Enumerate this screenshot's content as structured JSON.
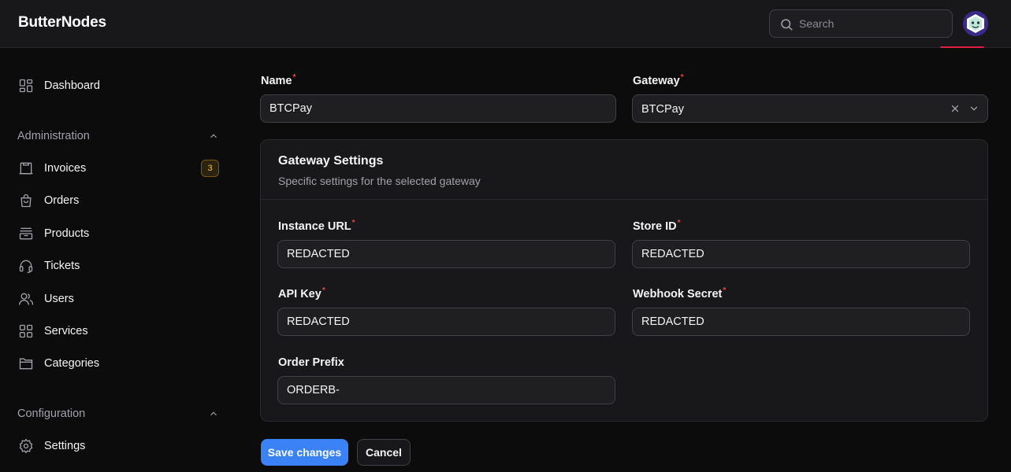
{
  "app": {
    "brand": "ButterNodes"
  },
  "search": {
    "placeholder": "Search",
    "value": ""
  },
  "sidebar": {
    "dashboard": {
      "label": "Dashboard",
      "icon": "dashboard-icon"
    },
    "groups": [
      {
        "title": "Administration",
        "items": [
          {
            "label": "Invoices",
            "icon": "invoice-icon",
            "badge": "3"
          },
          {
            "label": "Orders",
            "icon": "shopping-bag-icon"
          },
          {
            "label": "Products",
            "icon": "archive-box-icon"
          },
          {
            "label": "Tickets",
            "icon": "headset-icon"
          },
          {
            "label": "Users",
            "icon": "users-icon"
          },
          {
            "label": "Services",
            "icon": "grid-icon"
          },
          {
            "label": "Categories",
            "icon": "folder-icon"
          }
        ]
      },
      {
        "title": "Configuration",
        "items": [
          {
            "label": "Settings",
            "icon": "gear-icon"
          }
        ]
      }
    ]
  },
  "form": {
    "name": {
      "label": "Name",
      "value": "BTCPay"
    },
    "gateway": {
      "label": "Gateway",
      "value": "BTCPay"
    },
    "settings_card": {
      "title": "Gateway Settings",
      "subtitle": "Specific settings for the selected gateway",
      "instance_url": {
        "label": "Instance URL",
        "value": "REDACTED"
      },
      "store_id": {
        "label": "Store ID",
        "value": "REDACTED"
      },
      "api_key": {
        "label": "API Key",
        "value": "REDACTED"
      },
      "webhook_secret": {
        "label": "Webhook Secret",
        "value": "REDACTED"
      },
      "order_prefix": {
        "label": "Order Prefix",
        "value": "ORDERB-"
      }
    },
    "save_label": "Save changes",
    "cancel_label": "Cancel"
  },
  "colors": {
    "accent": "#3b82f6",
    "required": "#ef4444",
    "badge": "#f5c451"
  }
}
